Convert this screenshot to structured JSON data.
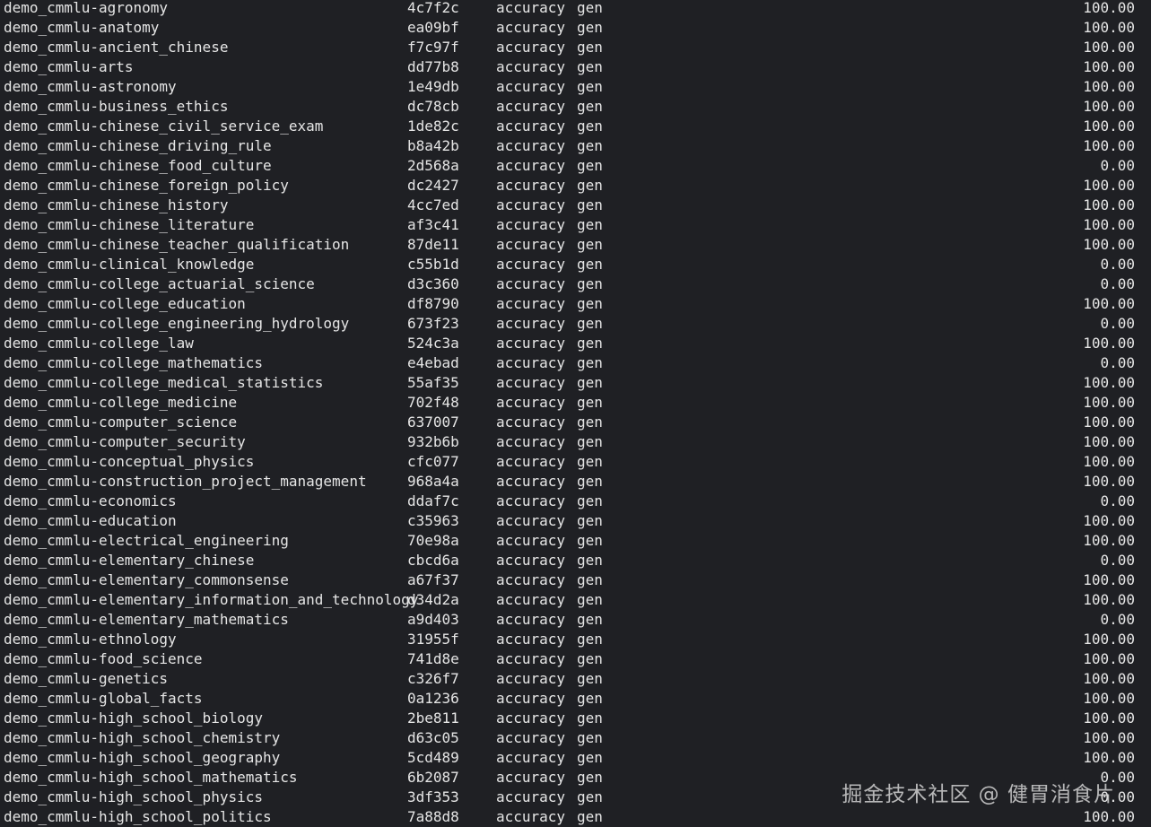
{
  "rows": [
    {
      "name": "demo_cmmlu-agronomy",
      "version": "4c7f2c",
      "metric": "accuracy",
      "mode": "gen",
      "score": "100.00"
    },
    {
      "name": "demo_cmmlu-anatomy",
      "version": "ea09bf",
      "metric": "accuracy",
      "mode": "gen",
      "score": "100.00"
    },
    {
      "name": "demo_cmmlu-ancient_chinese",
      "version": "f7c97f",
      "metric": "accuracy",
      "mode": "gen",
      "score": "100.00"
    },
    {
      "name": "demo_cmmlu-arts",
      "version": "dd77b8",
      "metric": "accuracy",
      "mode": "gen",
      "score": "100.00"
    },
    {
      "name": "demo_cmmlu-astronomy",
      "version": "1e49db",
      "metric": "accuracy",
      "mode": "gen",
      "score": "100.00"
    },
    {
      "name": "demo_cmmlu-business_ethics",
      "version": "dc78cb",
      "metric": "accuracy",
      "mode": "gen",
      "score": "100.00"
    },
    {
      "name": "demo_cmmlu-chinese_civil_service_exam",
      "version": "1de82c",
      "metric": "accuracy",
      "mode": "gen",
      "score": "100.00"
    },
    {
      "name": "demo_cmmlu-chinese_driving_rule",
      "version": "b8a42b",
      "metric": "accuracy",
      "mode": "gen",
      "score": "100.00"
    },
    {
      "name": "demo_cmmlu-chinese_food_culture",
      "version": "2d568a",
      "metric": "accuracy",
      "mode": "gen",
      "score": "0.00"
    },
    {
      "name": "demo_cmmlu-chinese_foreign_policy",
      "version": "dc2427",
      "metric": "accuracy",
      "mode": "gen",
      "score": "100.00"
    },
    {
      "name": "demo_cmmlu-chinese_history",
      "version": "4cc7ed",
      "metric": "accuracy",
      "mode": "gen",
      "score": "100.00"
    },
    {
      "name": "demo_cmmlu-chinese_literature",
      "version": "af3c41",
      "metric": "accuracy",
      "mode": "gen",
      "score": "100.00"
    },
    {
      "name": "demo_cmmlu-chinese_teacher_qualification",
      "version": "87de11",
      "metric": "accuracy",
      "mode": "gen",
      "score": "100.00"
    },
    {
      "name": "demo_cmmlu-clinical_knowledge",
      "version": "c55b1d",
      "metric": "accuracy",
      "mode": "gen",
      "score": "0.00"
    },
    {
      "name": "demo_cmmlu-college_actuarial_science",
      "version": "d3c360",
      "metric": "accuracy",
      "mode": "gen",
      "score": "0.00"
    },
    {
      "name": "demo_cmmlu-college_education",
      "version": "df8790",
      "metric": "accuracy",
      "mode": "gen",
      "score": "100.00"
    },
    {
      "name": "demo_cmmlu-college_engineering_hydrology",
      "version": "673f23",
      "metric": "accuracy",
      "mode": "gen",
      "score": "0.00"
    },
    {
      "name": "demo_cmmlu-college_law",
      "version": "524c3a",
      "metric": "accuracy",
      "mode": "gen",
      "score": "100.00"
    },
    {
      "name": "demo_cmmlu-college_mathematics",
      "version": "e4ebad",
      "metric": "accuracy",
      "mode": "gen",
      "score": "0.00"
    },
    {
      "name": "demo_cmmlu-college_medical_statistics",
      "version": "55af35",
      "metric": "accuracy",
      "mode": "gen",
      "score": "100.00"
    },
    {
      "name": "demo_cmmlu-college_medicine",
      "version": "702f48",
      "metric": "accuracy",
      "mode": "gen",
      "score": "100.00"
    },
    {
      "name": "demo_cmmlu-computer_science",
      "version": "637007",
      "metric": "accuracy",
      "mode": "gen",
      "score": "100.00"
    },
    {
      "name": "demo_cmmlu-computer_security",
      "version": "932b6b",
      "metric": "accuracy",
      "mode": "gen",
      "score": "100.00"
    },
    {
      "name": "demo_cmmlu-conceptual_physics",
      "version": "cfc077",
      "metric": "accuracy",
      "mode": "gen",
      "score": "100.00"
    },
    {
      "name": "demo_cmmlu-construction_project_management",
      "version": "968a4a",
      "metric": "accuracy",
      "mode": "gen",
      "score": "100.00"
    },
    {
      "name": "demo_cmmlu-economics",
      "version": "ddaf7c",
      "metric": "accuracy",
      "mode": "gen",
      "score": "0.00"
    },
    {
      "name": "demo_cmmlu-education",
      "version": "c35963",
      "metric": "accuracy",
      "mode": "gen",
      "score": "100.00"
    },
    {
      "name": "demo_cmmlu-electrical_engineering",
      "version": "70e98a",
      "metric": "accuracy",
      "mode": "gen",
      "score": "100.00"
    },
    {
      "name": "demo_cmmlu-elementary_chinese",
      "version": "cbcd6a",
      "metric": "accuracy",
      "mode": "gen",
      "score": "0.00"
    },
    {
      "name": "demo_cmmlu-elementary_commonsense",
      "version": "a67f37",
      "metric": "accuracy",
      "mode": "gen",
      "score": "100.00"
    },
    {
      "name": "demo_cmmlu-elementary_information_and_technology",
      "version": "d34d2a",
      "metric": "accuracy",
      "mode": "gen",
      "score": "100.00"
    },
    {
      "name": "demo_cmmlu-elementary_mathematics",
      "version": "a9d403",
      "metric": "accuracy",
      "mode": "gen",
      "score": "0.00"
    },
    {
      "name": "demo_cmmlu-ethnology",
      "version": "31955f",
      "metric": "accuracy",
      "mode": "gen",
      "score": "100.00"
    },
    {
      "name": "demo_cmmlu-food_science",
      "version": "741d8e",
      "metric": "accuracy",
      "mode": "gen",
      "score": "100.00"
    },
    {
      "name": "demo_cmmlu-genetics",
      "version": "c326f7",
      "metric": "accuracy",
      "mode": "gen",
      "score": "100.00"
    },
    {
      "name": "demo_cmmlu-global_facts",
      "version": "0a1236",
      "metric": "accuracy",
      "mode": "gen",
      "score": "100.00"
    },
    {
      "name": "demo_cmmlu-high_school_biology",
      "version": "2be811",
      "metric": "accuracy",
      "mode": "gen",
      "score": "100.00"
    },
    {
      "name": "demo_cmmlu-high_school_chemistry",
      "version": "d63c05",
      "metric": "accuracy",
      "mode": "gen",
      "score": "100.00"
    },
    {
      "name": "demo_cmmlu-high_school_geography",
      "version": "5cd489",
      "metric": "accuracy",
      "mode": "gen",
      "score": "100.00"
    },
    {
      "name": "demo_cmmlu-high_school_mathematics",
      "version": "6b2087",
      "metric": "accuracy",
      "mode": "gen",
      "score": "0.00"
    },
    {
      "name": "demo_cmmlu-high_school_physics",
      "version": "3df353",
      "metric": "accuracy",
      "mode": "gen",
      "score": "0.00"
    },
    {
      "name": "demo_cmmlu-high_school_politics",
      "version": "7a88d8",
      "metric": "accuracy",
      "mode": "gen",
      "score": "100.00"
    }
  ],
  "watermark": "掘金技术社区 @ 健胃消食片",
  "colors": {
    "background": "#1f2024",
    "text": "#e6e6e6"
  }
}
